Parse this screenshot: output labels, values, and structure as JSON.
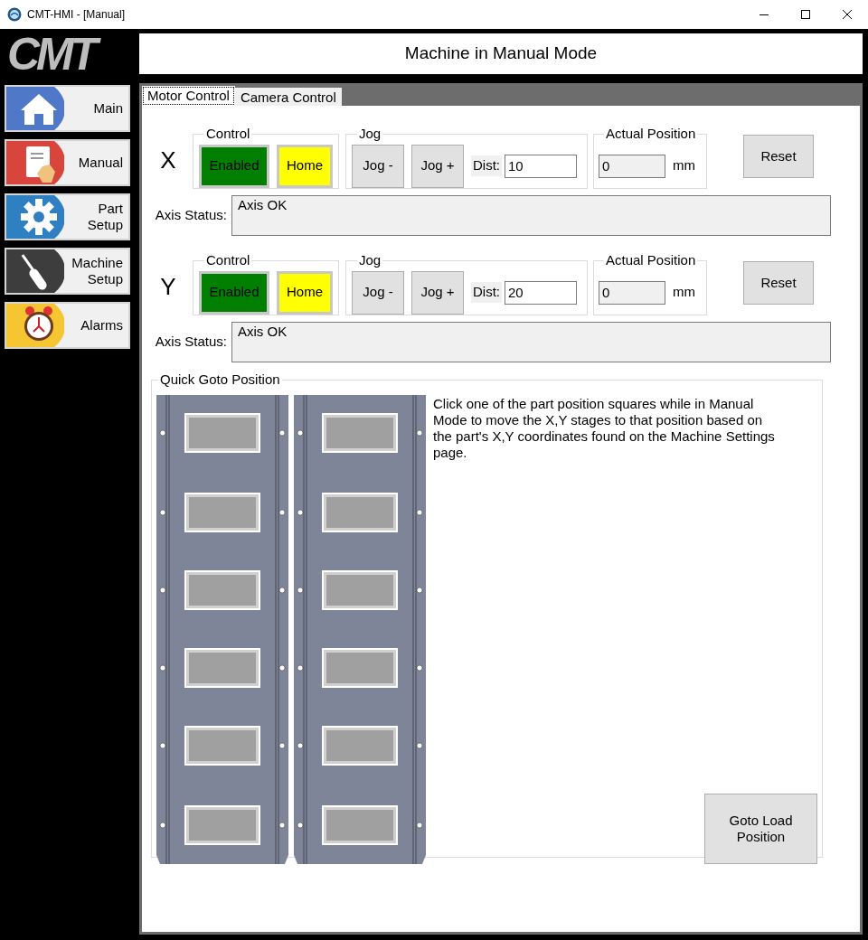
{
  "window": {
    "title": "CMT-HMI - [Manual]"
  },
  "logo": {
    "text": "CMT"
  },
  "sidebar": {
    "items": [
      {
        "label": "Main",
        "kind": "home"
      },
      {
        "label": "Manual",
        "kind": "manual"
      },
      {
        "label": "Part Setup",
        "kind": "gear"
      },
      {
        "label": "Machine Setup",
        "kind": "screwdriver"
      },
      {
        "label": "Alarms",
        "kind": "alarm"
      }
    ]
  },
  "header": {
    "title": "Machine in Manual Mode"
  },
  "tabs": [
    {
      "label": "Motor Control",
      "selected": true
    },
    {
      "label": "Camera Control",
      "selected": false
    }
  ],
  "axes": [
    {
      "axis": "X",
      "control_title": "Control",
      "enabled_button": "Enabled",
      "enabled": true,
      "home_button": "Home",
      "jog_title": "Jog",
      "jog_minus": "Jog -",
      "jog_plus": "Jog +",
      "dist_label": "Dist:",
      "dist_value": "10",
      "position_title": "Actual Position",
      "position_value": "0",
      "unit": "mm",
      "reset_button": "Reset",
      "status_label": "Axis Status:",
      "status_value": "Axis OK"
    },
    {
      "axis": "Y",
      "control_title": "Control",
      "enabled_button": "Enabled",
      "enabled": true,
      "home_button": "Home",
      "jog_title": "Jog",
      "jog_minus": "Jog -",
      "jog_plus": "Jog +",
      "dist_label": "Dist:",
      "dist_value": "20",
      "position_title": "Actual Position",
      "position_value": "0",
      "unit": "mm",
      "reset_button": "Reset",
      "status_label": "Axis Status:",
      "status_value": "Axis OK"
    }
  ],
  "quick_goto": {
    "title": "Quick Goto Position",
    "instructions": "Click one of the part position squares while in Manual Mode to move the X,Y stages to that position based on the part's X,Y coordinates found on the Machine Settings page.",
    "goto_load_button": "Goto Load Position"
  }
}
